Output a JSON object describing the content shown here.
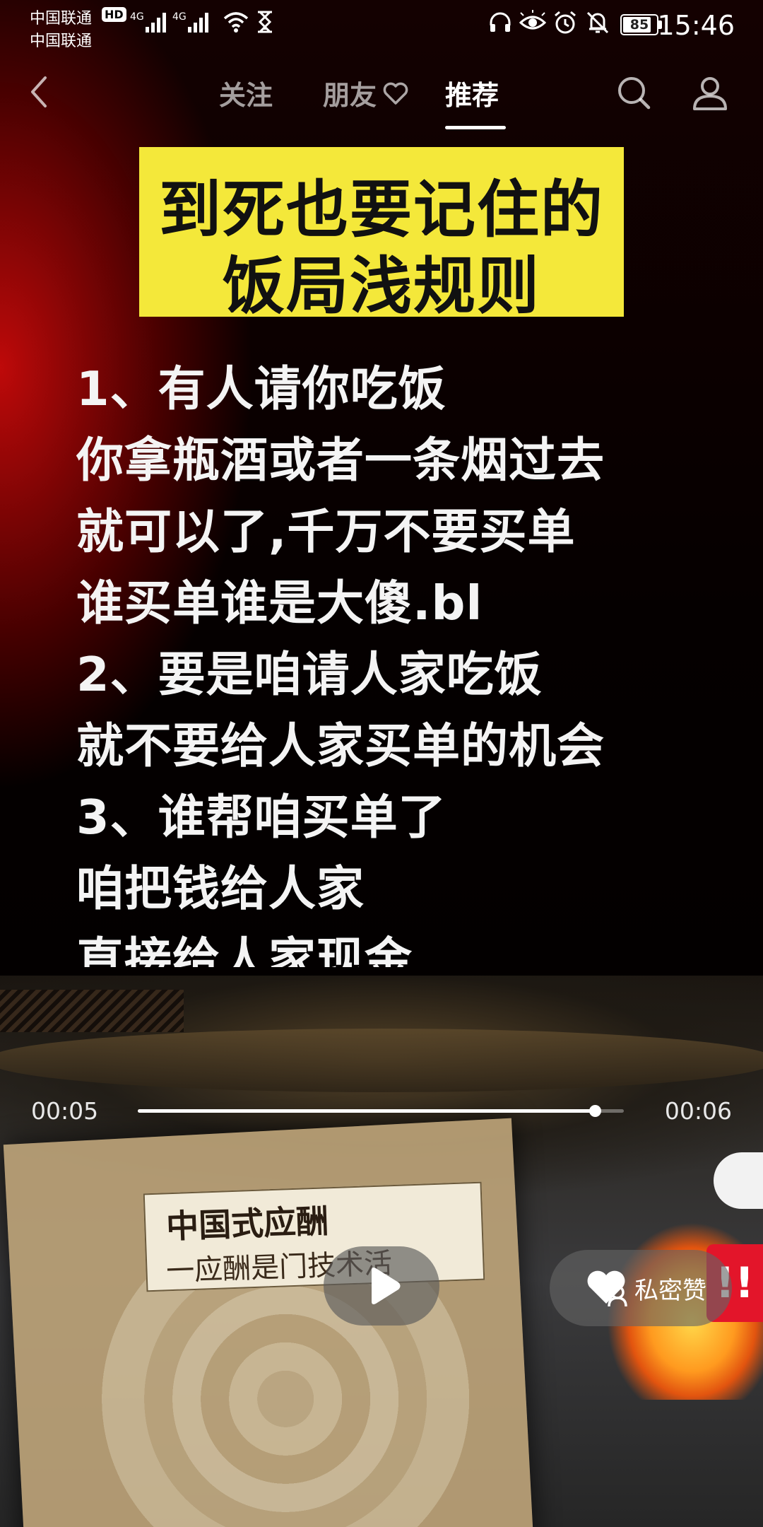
{
  "status_bar": {
    "carrier_1": "中国联通",
    "carrier_2": "中国联通",
    "hd_badge": "HD",
    "network_1": "4G",
    "network_2": "4G",
    "battery": "85",
    "battery_level_percent": 85,
    "time": "15:46",
    "icons": [
      "signal-icon",
      "wifi-icon",
      "hourglass-icon",
      "headset-icon",
      "eye-icon",
      "alarm-icon",
      "mute-icon",
      "battery-icon"
    ]
  },
  "top_nav": {
    "tabs": [
      {
        "label": "关注",
        "active": false
      },
      {
        "label": "朋友",
        "active": false
      },
      {
        "label": "推荐",
        "active": true
      }
    ],
    "icons": [
      "back-icon",
      "heart-icon",
      "search-icon",
      "profile-icon"
    ]
  },
  "video": {
    "title_lines": [
      "到死也要记住的",
      "饭局浅规则"
    ],
    "title_bg_color": "#f4e83a",
    "body_lines": [
      "1、有人请你吃饭",
      "你拿瓶酒或者一条烟过去",
      "就可以了,千万不要买单",
      "谁买单谁是大傻.bl",
      "2、要是咱请人家吃饭",
      "就不要给人家买单的机会",
      "3、谁帮咱买单了",
      "咱把钱给人家",
      "直接给人家现金"
    ],
    "book_title": "中国式应酬",
    "book_subtitle": "一应酬是门技术活",
    "fire_badge": "!!"
  },
  "player": {
    "current_time": "00:05",
    "total_time": "00:06",
    "progress_fraction": 0.94,
    "private_like_label": "私密赞",
    "icons": [
      "play-icon",
      "private-like-icon"
    ]
  }
}
